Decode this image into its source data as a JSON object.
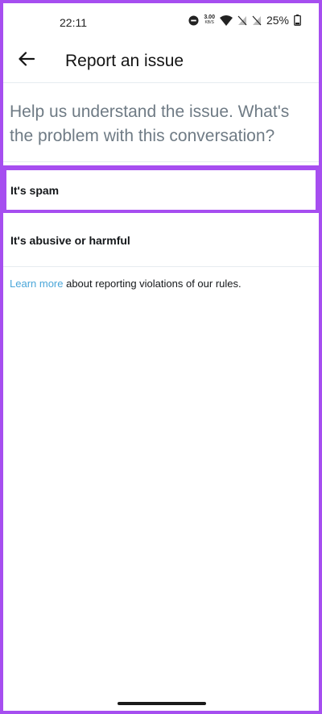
{
  "status_bar": {
    "time": "22:11",
    "net_speed_value": "3.00",
    "net_speed_unit": "KB/S",
    "battery_percent": "25%"
  },
  "header": {
    "title": "Report an issue"
  },
  "prompt": "Help us understand the issue. What's the problem with this conversation?",
  "options": [
    {
      "label": "It's spam"
    },
    {
      "label": "It's abusive or harmful"
    }
  ],
  "footer": {
    "link_text": "Learn more",
    "text": " about reporting violations of our rules."
  },
  "colors": {
    "highlight": "#a64ef0",
    "link": "#4aa6d9"
  }
}
